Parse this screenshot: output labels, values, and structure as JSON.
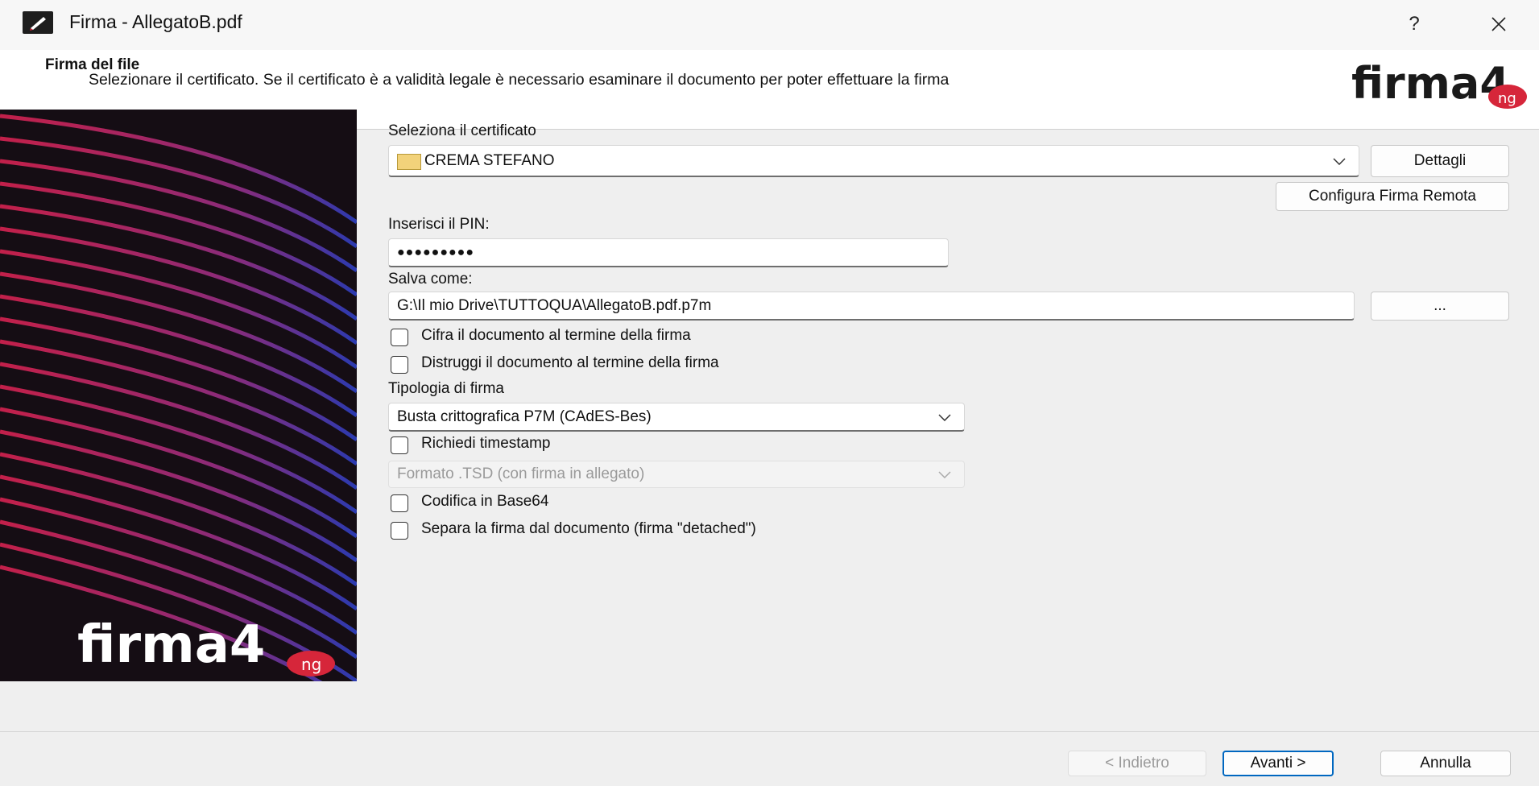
{
  "window": {
    "title": "Firma - AllegatoB.pdf",
    "help_label": "?",
    "close_label": "✕"
  },
  "header": {
    "title": "Firma del file",
    "subtitle": "Selezionare il certificato. Se il certificato è a validità legale è necessario esaminare il documento per poter effettuare la firma",
    "logo_text": "firma4",
    "logo_suffix": "ng"
  },
  "banner": {
    "logo_text": "firma4",
    "logo_suffix": "ng"
  },
  "form": {
    "certificate_label": "Seleziona il certificato",
    "certificate_value": "CREMA STEFANO",
    "details_button": "Dettagli",
    "remote_button": "Configura Firma Remota",
    "pin_label": "Inserisci il PIN:",
    "pin_value": "●●●●●●●●●",
    "save_label": "Salva come:",
    "save_value": "G:\\Il mio Drive\\TUTTOQUA\\AllegatoB.pdf.p7m",
    "browse_button": "...",
    "encrypt_checkbox": "Cifra il documento al termine della firma",
    "destroy_checkbox": "Distruggi il documento al termine della firma",
    "signature_type_label": "Tipologia di firma",
    "signature_type_value": "Busta crittografica P7M (CAdES-Bes)",
    "timestamp_checkbox": "Richiedi timestamp",
    "timestamp_format_value": "Formato .TSD (con firma in allegato)",
    "base64_checkbox": "Codifica in Base64",
    "detached_checkbox": "Separa la firma dal documento (firma \"detached\")"
  },
  "footer": {
    "back_button": "< Indietro",
    "next_button": "Avanti >",
    "cancel_button": "Annulla"
  },
  "colors": {
    "accent": "#0067c0",
    "brand_red": "#d6263a",
    "banner_bg": "#150d14"
  }
}
